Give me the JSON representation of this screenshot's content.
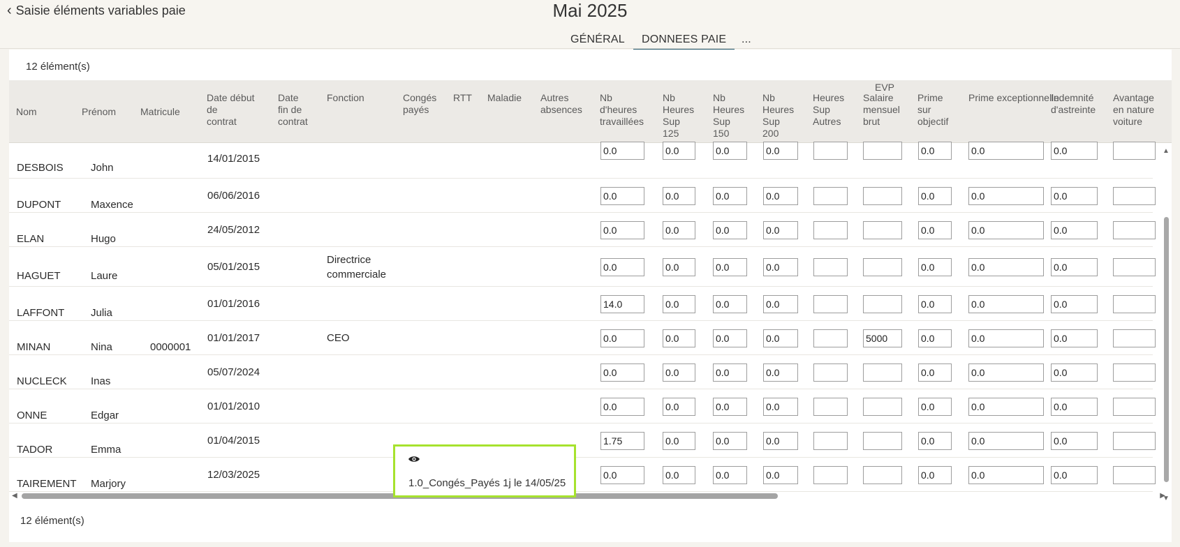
{
  "header": {
    "back_label": "Saisie éléments variables paie",
    "title": "Mai 2025",
    "tabs": [
      {
        "label": "GÉNÉRAL",
        "active": false
      },
      {
        "label": "DONNEES PAIE",
        "active": true
      },
      {
        "label": "...",
        "active": false
      }
    ]
  },
  "list": {
    "count_label": "12 élément(s)",
    "group_header": "EVP",
    "columns": {
      "nom": "Nom",
      "prenom": "Prénom",
      "matricule": "Matricule",
      "date_debut": [
        "Date début",
        "de",
        "contrat"
      ],
      "date_fin": [
        "Date",
        "fin de",
        "contrat"
      ],
      "fonction": "Fonction",
      "conges": [
        "Congés",
        "payés"
      ],
      "rtt": "RTT",
      "maladie": "Maladie",
      "autres_absences": [
        "Autres",
        "absences"
      ],
      "nb_heures": [
        "Nb",
        "d'heures",
        "travaillées"
      ],
      "hs125": [
        "Nb",
        "Heures",
        "Sup",
        "125"
      ],
      "hs150": [
        "Nb",
        "Heures",
        "Sup",
        "150"
      ],
      "hs200": [
        "Nb",
        "Heures",
        "Sup",
        "200"
      ],
      "hs_autres": [
        "Heures",
        "Sup",
        "Autres"
      ],
      "salaire": [
        "Salaire",
        "mensuel",
        "brut"
      ],
      "prime_obj": [
        "Prime",
        "sur",
        "objectif"
      ],
      "prime_exc": "Prime exceptionnelle",
      "indemnite": [
        "Indemnité",
        "d'astreinte"
      ],
      "avantage": [
        "Avantage",
        "en nature",
        "voiture"
      ]
    },
    "rows": [
      {
        "nom": "DESBOIS",
        "prenom": "John",
        "matricule": "",
        "date_debut": "14/01/2015",
        "fonction": "",
        "nb_heures": "0.0",
        "hs125": "0.0",
        "hs150": "0.0",
        "hs200": "0.0",
        "hs_autres": "",
        "salaire": "",
        "prime_obj": "0.0",
        "prime_exc": "0.0",
        "indemnite": "0.0",
        "avantage": ""
      },
      {
        "nom": "DUPONT",
        "prenom": "Maxence",
        "matricule": "",
        "date_debut": "06/06/2016",
        "fonction": "",
        "nb_heures": "0.0",
        "hs125": "0.0",
        "hs150": "0.0",
        "hs200": "0.0",
        "hs_autres": "",
        "salaire": "",
        "prime_obj": "0.0",
        "prime_exc": "0.0",
        "indemnite": "0.0",
        "avantage": ""
      },
      {
        "nom": "ELAN",
        "prenom": "Hugo",
        "matricule": "",
        "date_debut": "24/05/2012",
        "fonction": "",
        "nb_heures": "0.0",
        "hs125": "0.0",
        "hs150": "0.0",
        "hs200": "0.0",
        "hs_autres": "",
        "salaire": "",
        "prime_obj": "0.0",
        "prime_exc": "0.0",
        "indemnite": "0.0",
        "avantage": ""
      },
      {
        "nom": "HAGUET",
        "prenom": "Laure",
        "matricule": "",
        "date_debut": "05/01/2015",
        "fonction": "Directrice commerciale",
        "nb_heures": "0.0",
        "hs125": "0.0",
        "hs150": "0.0",
        "hs200": "0.0",
        "hs_autres": "",
        "salaire": "",
        "prime_obj": "0.0",
        "prime_exc": "0.0",
        "indemnite": "0.0",
        "avantage": ""
      },
      {
        "nom": "LAFFONT",
        "prenom": "Julia",
        "matricule": "",
        "date_debut": "01/01/2016",
        "fonction": "",
        "nb_heures": "14.0",
        "hs125": "0.0",
        "hs150": "0.0",
        "hs200": "0.0",
        "hs_autres": "",
        "salaire": "",
        "prime_obj": "0.0",
        "prime_exc": "0.0",
        "indemnite": "0.0",
        "avantage": ""
      },
      {
        "nom": "MINAN",
        "prenom": "Nina",
        "matricule": "0000001",
        "date_debut": "01/01/2017",
        "fonction": "CEO",
        "nb_heures": "0.0",
        "hs125": "0.0",
        "hs150": "0.0",
        "hs200": "0.0",
        "hs_autres": "",
        "salaire": "5000",
        "prime_obj": "0.0",
        "prime_exc": "0.0",
        "indemnite": "0.0",
        "avantage": ""
      },
      {
        "nom": "NUCLECK",
        "prenom": "Inas",
        "matricule": "",
        "date_debut": "05/07/2024",
        "fonction": "",
        "nb_heures": "0.0",
        "hs125": "0.0",
        "hs150": "0.0",
        "hs200": "0.0",
        "hs_autres": "",
        "salaire": "",
        "prime_obj": "0.0",
        "prime_exc": "0.0",
        "indemnite": "0.0",
        "avantage": ""
      },
      {
        "nom": "ONNE",
        "prenom": "Edgar",
        "matricule": "",
        "date_debut": "01/01/2010",
        "fonction": "",
        "nb_heures": "0.0",
        "hs125": "0.0",
        "hs150": "0.0",
        "hs200": "0.0",
        "hs_autres": "",
        "salaire": "",
        "prime_obj": "0.0",
        "prime_exc": "0.0",
        "indemnite": "0.0",
        "avantage": ""
      },
      {
        "nom": "TADOR",
        "prenom": "Emma",
        "matricule": "",
        "date_debut": "01/04/2015",
        "fonction": "",
        "nb_heures": "1.75",
        "hs125": "0.0",
        "hs150": "0.0",
        "hs200": "0.0",
        "hs_autres": "",
        "salaire": "",
        "prime_obj": "0.0",
        "prime_exc": "0.0",
        "indemnite": "0.0",
        "avantage": ""
      },
      {
        "nom": "TAIREMENT",
        "prenom": "Marjory",
        "matricule": "",
        "date_debut": "12/03/2025",
        "fonction": "",
        "nb_heures": "0.0",
        "hs125": "0.0",
        "hs150": "0.0",
        "hs200": "0.0",
        "hs_autres": "",
        "salaire": "",
        "prime_obj": "0.0",
        "prime_exc": "0.0",
        "indemnite": "0.0",
        "avantage": ""
      }
    ]
  },
  "tooltip": {
    "icon": "eye-icon",
    "text": "1.0_Congés_Payés 1j le 14/05/25",
    "border_color": "#a6e22e"
  },
  "colors": {
    "accent": "#1f5367",
    "header_bg": "#eceae6",
    "page_bg": "#f5f3ee"
  }
}
